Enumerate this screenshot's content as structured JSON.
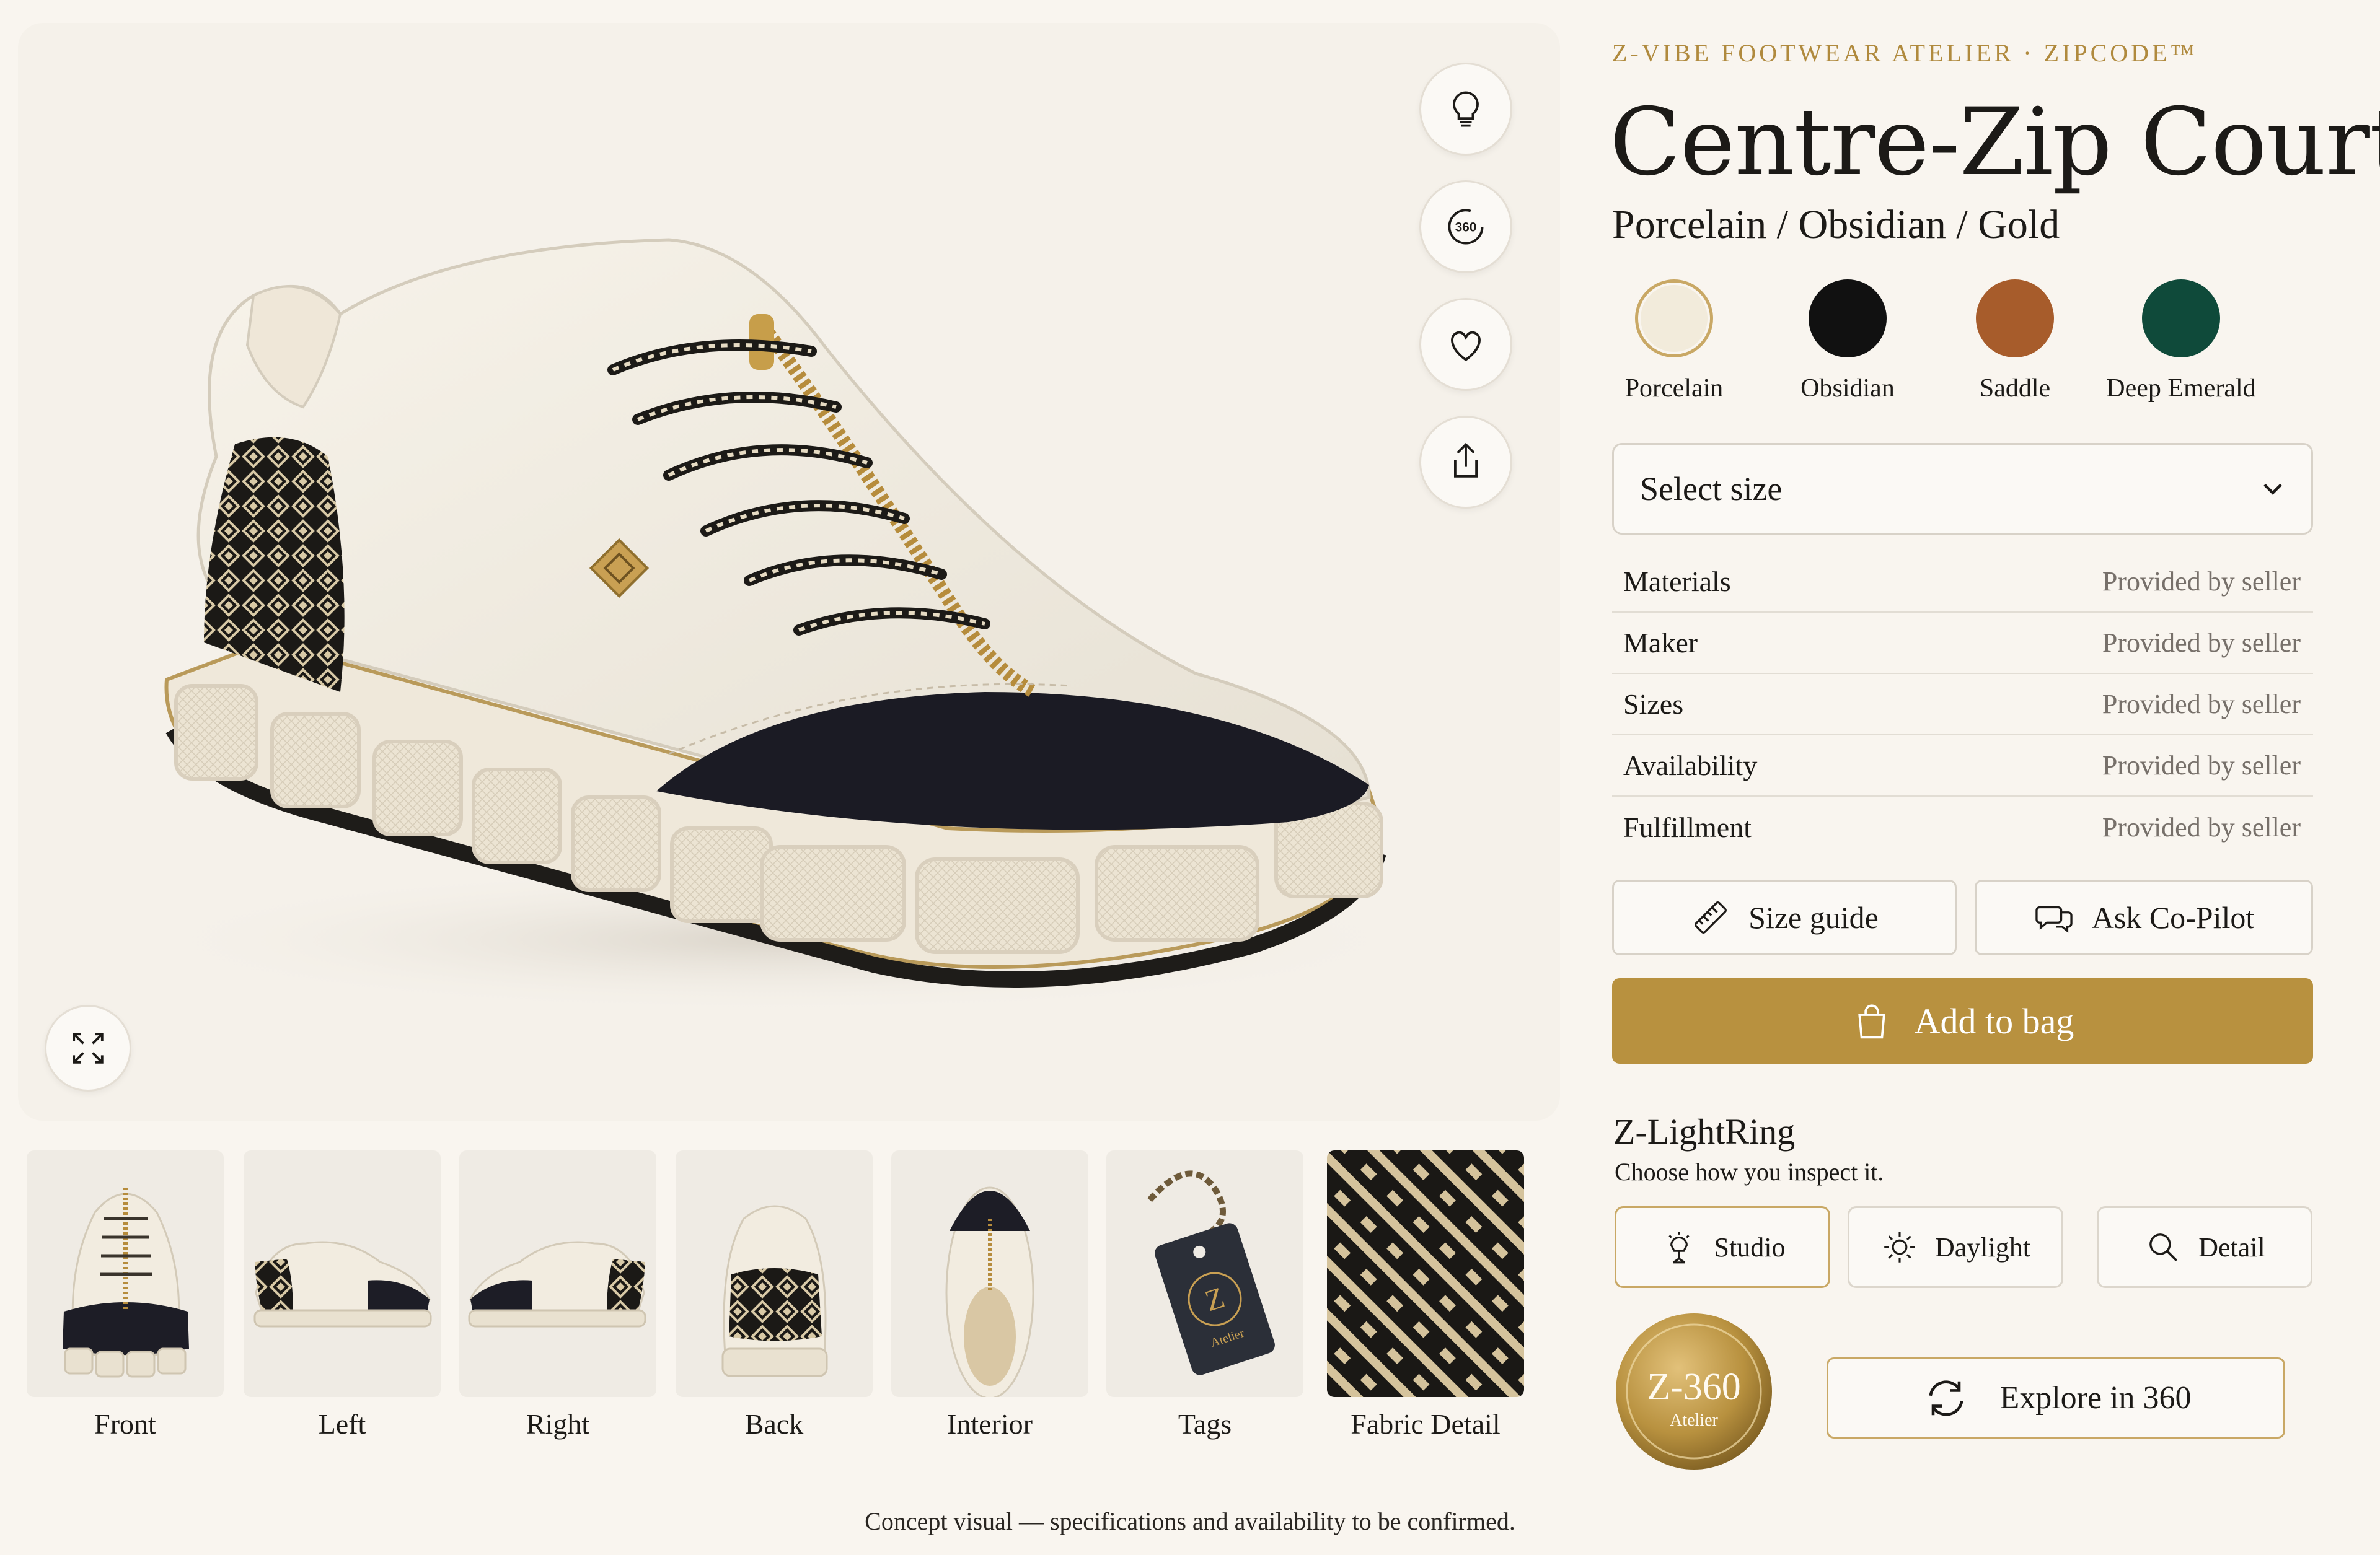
{
  "brand_line": "Z-VIBE FOOTWEAR ATELIER · ZIPCODE™",
  "product": {
    "title": "Centre-Zip Court",
    "colorway": "Porcelain / Obsidian / Gold"
  },
  "swatches": [
    {
      "label": "Porcelain",
      "color": "#f2ebdb",
      "selected": true
    },
    {
      "label": "Obsidian",
      "color": "#111111",
      "selected": false
    },
    {
      "label": "Saddle",
      "color": "#a75c2b",
      "selected": false
    },
    {
      "label": "Deep Emerald",
      "color": "#0f4a3a",
      "selected": false
    }
  ],
  "stage_controls": {
    "lightbulb": "lightbulb-icon",
    "view360": "360",
    "favorite": "heart-icon",
    "share": "share-icon",
    "expand": "expand-icon"
  },
  "size_select": {
    "placeholder": "Select size"
  },
  "specs": [
    {
      "key": "Materials",
      "value": "Provided by seller"
    },
    {
      "key": "Maker",
      "value": "Provided by seller"
    },
    {
      "key": "Sizes",
      "value": "Provided by seller"
    },
    {
      "key": "Availability",
      "value": "Provided by seller"
    },
    {
      "key": "Fulfillment",
      "value": "Provided by seller"
    }
  ],
  "actions": {
    "size_guide": "Size guide",
    "ask_copilot": "Ask Co-Pilot",
    "add_to_bag": "Add to bag"
  },
  "lightring": {
    "title": "Z-LightRing",
    "subtitle": "Choose how you inspect it.",
    "modes": [
      {
        "label": "Studio",
        "active": true
      },
      {
        "label": "Daylight",
        "active": false
      },
      {
        "label": "Detail",
        "active": false
      }
    ]
  },
  "medallion": {
    "main": "Z-360",
    "sub": "Atelier"
  },
  "explore_360": "Explore in 360",
  "thumbnails": [
    "Front",
    "Left",
    "Right",
    "Back",
    "Interior",
    "Tags",
    "Fabric Detail"
  ],
  "tag_text": {
    "letter": "Z",
    "sub": "Atelier"
  },
  "footer_note": "Concept visual — specifications and availability to be confirmed.",
  "colors": {
    "accent_gold": "#b8913f",
    "background": "#f9f5ef",
    "text": "#1c1a17",
    "muted": "#77706a"
  }
}
